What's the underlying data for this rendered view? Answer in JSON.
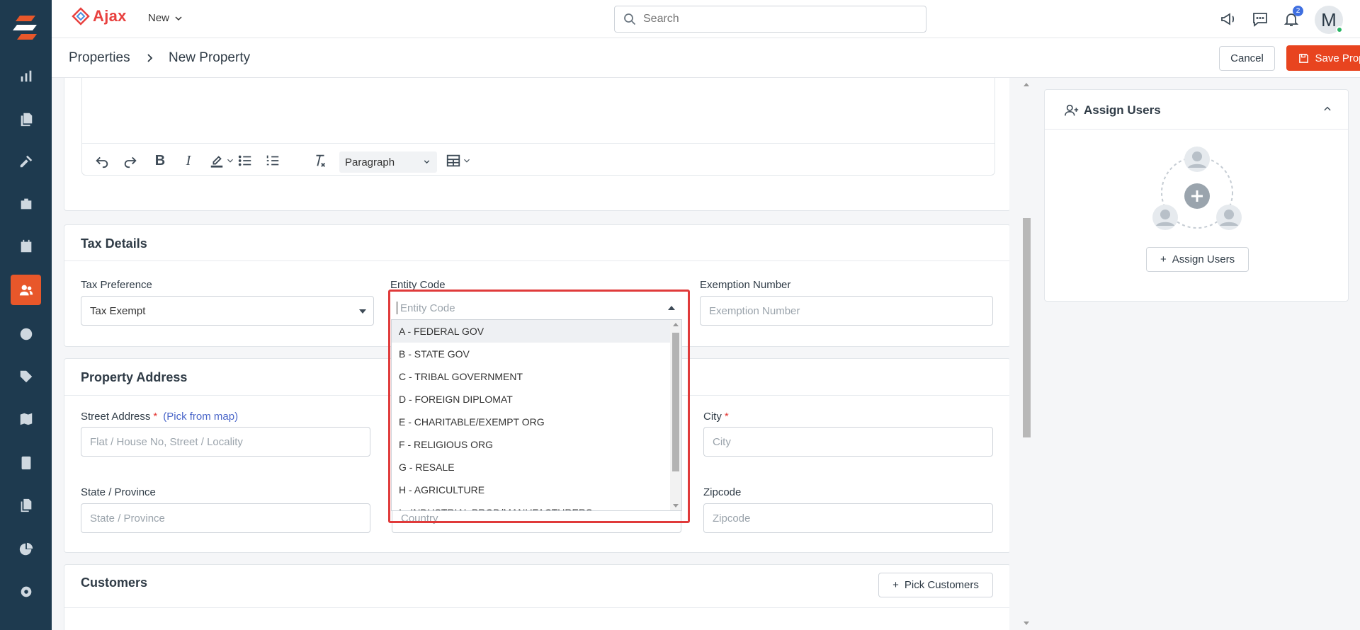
{
  "app": {
    "brand": "Ajax",
    "new_label": "New"
  },
  "search": {
    "placeholder": "Search"
  },
  "notifications": {
    "count": "2"
  },
  "user": {
    "initial": "M"
  },
  "breadcrumb": {
    "parent": "Properties",
    "current": "New Property"
  },
  "actions": {
    "cancel": "Cancel",
    "save": "Save Property"
  },
  "editor": {
    "block_format": "Paragraph"
  },
  "tax": {
    "title": "Tax Details",
    "preference_label": "Tax Preference",
    "preference_value": "Tax Exempt",
    "entity_label": "Entity Code",
    "entity_placeholder": "Entity Code",
    "exemption_label": "Exemption Number",
    "exemption_placeholder": "Exemption Number"
  },
  "entity_options": [
    "A - FEDERAL GOV",
    "B - STATE GOV",
    "C - TRIBAL GOVERNMENT",
    "D - FOREIGN DIPLOMAT",
    "E - CHARITABLE/EXEMPT ORG",
    "F - RELIGIOUS ORG",
    "G - RESALE",
    "H - AGRICULTURE",
    "I - INDUSTRIAL PROD/MANUFACTURERS"
  ],
  "address": {
    "title": "Property Address",
    "street_label": "Street Address",
    "pick_from_map": "(Pick from map)",
    "street_placeholder": "Flat / House No, Street / Locality",
    "city_label": "City",
    "city_placeholder": "City",
    "state_label": "State / Province",
    "state_placeholder": "State / Province",
    "country_placeholder": "Country",
    "zip_label": "Zipcode",
    "zip_placeholder": "Zipcode"
  },
  "customers": {
    "title": "Customers",
    "pick_button": "Pick Customers"
  },
  "assign": {
    "title": "Assign Users",
    "button": "Assign Users"
  }
}
